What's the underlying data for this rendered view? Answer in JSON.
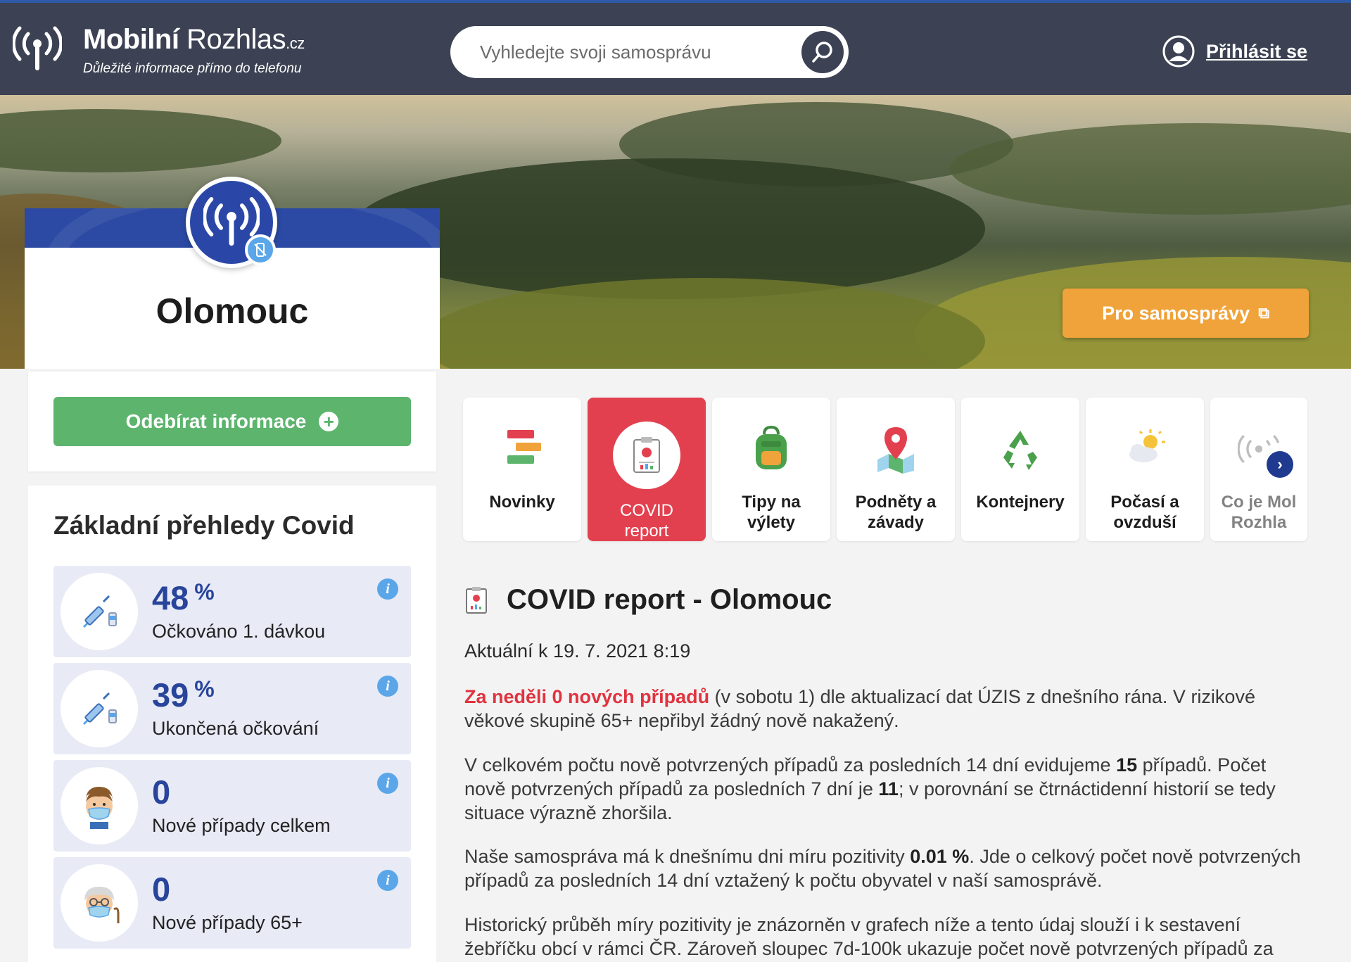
{
  "header": {
    "brand_bold": "Mobilní",
    "brand_light": "Rozhlas",
    "brand_tld": ".cz",
    "tagline": "Důležité informace přímo do telefonu",
    "search_placeholder": "Vyhledejte svoji samosprávu",
    "login_label": "Přihlásit se"
  },
  "hero": {
    "pro_button_label": "Pro samosprávy",
    "city_name": "Olomouc"
  },
  "sidebar": {
    "subscribe_label": "Odebírat informace",
    "covid_title": "Základní přehledy Covid",
    "stats": [
      {
        "value": "48",
        "unit": "%",
        "label": "Očkováno 1. dávkou",
        "icon": "vaccine-syringe-icon"
      },
      {
        "value": "39",
        "unit": "%",
        "label": "Ukončená očkování",
        "icon": "vaccine-syringe-icon"
      },
      {
        "value": "0",
        "unit": "",
        "label": "Nové případy celkem",
        "icon": "masked-person-icon"
      },
      {
        "value": "0",
        "unit": "",
        "label": "Nové případy 65+",
        "icon": "masked-senior-icon"
      }
    ]
  },
  "tiles": [
    {
      "label_1": "Novinky",
      "label_2": "",
      "icon": "news-icon"
    },
    {
      "label_1": "COVID",
      "label_2": "report",
      "icon": "covid-report-icon",
      "active": true
    },
    {
      "label_1": "Tipy na",
      "label_2": "výlety",
      "icon": "backpack-icon"
    },
    {
      "label_1": "Podněty a",
      "label_2": "závady",
      "icon": "map-pin-icon"
    },
    {
      "label_1": "Kontejnery",
      "label_2": "",
      "icon": "recycle-icon"
    },
    {
      "label_1": "Počasí a",
      "label_2": "ovzduší",
      "icon": "weather-icon"
    },
    {
      "label_1": "Co je Mol",
      "label_2": "Rozhla",
      "icon": "broadcast-icon"
    }
  ],
  "report": {
    "title": "COVID report - Olomouc",
    "updated": "Aktuální k 19. 7. 2021 8:19",
    "p1_highlight": "Za neděli 0 nových případů",
    "p1_rest": " (v sobotu 1) dle aktualizací dat ÚZIS z dnešního rána. V rizikové věkové skupině 65+ nepřibyl žádný nově nakažený.",
    "p2_a": "V celkovém počtu nově potvrzených případů za posledních 14 dní evidujeme ",
    "p2_b": "15",
    "p2_c": " případů. Počet nově potvrzených případů za posledních 7 dní je ",
    "p2_d": "11",
    "p2_e": "; v porovnání se čtrnáctidenní historií se tedy situace výrazně zhoršila.",
    "p3_a": "Naše samospráva má k dnešnímu dni míru pozitivity ",
    "p3_b": "0.01 %",
    "p3_c": ". Jde o celkový počet nově potvrzených případů za posledních 14 dní vztažený k počtu obyvatel v naší samosprávě.",
    "p4": "Historický průběh míry pozitivity je znázorněn v grafech níže a tento údaj slouží i k sestavení žebříčku obcí v rámci ČR. Zároveň sloupec 7d-100k ukazuje počet nově potvrzených případů za"
  },
  "colors": {
    "header_bg": "#3c4253",
    "accent_blue": "#28449b",
    "active_tile": "#e3404f",
    "subscribe_green": "#5cb46d",
    "pro_orange": "#f0a33a"
  }
}
